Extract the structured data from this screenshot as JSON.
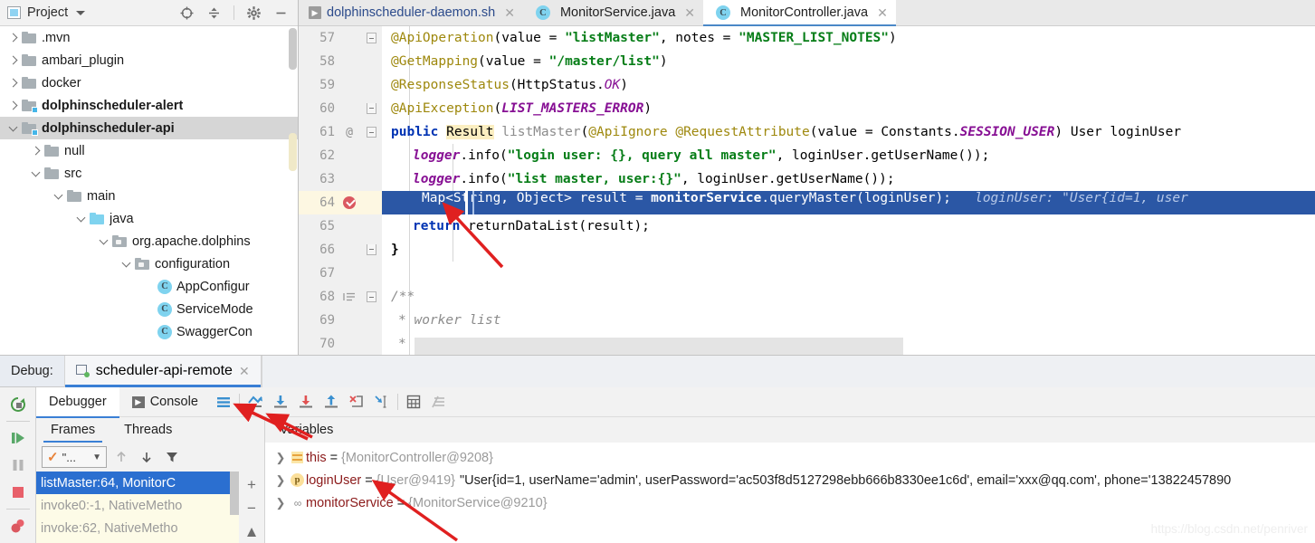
{
  "project_panel": {
    "title": "Project",
    "header_icons": [
      "locate-icon",
      "collapse-all-icon",
      "gear-icon",
      "minimize-icon"
    ],
    "tree": [
      {
        "label": ".mvn",
        "indent": 1,
        "arrow": "right",
        "icon": "folder",
        "bold": false
      },
      {
        "label": "ambari_plugin",
        "indent": 1,
        "arrow": "right",
        "icon": "folder",
        "bold": false
      },
      {
        "label": "docker",
        "indent": 1,
        "arrow": "right",
        "icon": "folder",
        "bold": false
      },
      {
        "label": "dolphinscheduler-alert",
        "indent": 1,
        "arrow": "right",
        "icon": "module",
        "bold": true
      },
      {
        "label": "dolphinscheduler-api",
        "indent": 1,
        "arrow": "down",
        "icon": "module",
        "bold": true,
        "selected": true
      },
      {
        "label": "null",
        "indent": 2,
        "arrow": "right",
        "icon": "folder",
        "bold": false
      },
      {
        "label": "src",
        "indent": 2,
        "arrow": "down",
        "icon": "folder",
        "bold": false
      },
      {
        "label": "main",
        "indent": 3,
        "arrow": "down",
        "icon": "folder",
        "bold": false
      },
      {
        "label": "java",
        "indent": 4,
        "arrow": "down",
        "icon": "folder-blue",
        "bold": false
      },
      {
        "label": "org.apache.dolphins",
        "indent": 5,
        "arrow": "down",
        "icon": "package",
        "bold": false
      },
      {
        "label": "configuration",
        "indent": 6,
        "arrow": "down",
        "icon": "package",
        "bold": false
      },
      {
        "label": "AppConfigur",
        "indent": 7,
        "arrow": "none",
        "icon": "class",
        "bold": false
      },
      {
        "label": "ServiceMode",
        "indent": 7,
        "arrow": "none",
        "icon": "class",
        "bold": false
      },
      {
        "label": "SwaggerCon",
        "indent": 7,
        "arrow": "none",
        "icon": "class",
        "bold": false
      }
    ]
  },
  "editor": {
    "tabs": [
      {
        "label": "dolphinscheduler-daemon.sh",
        "icon": "shell-script-icon",
        "active": false
      },
      {
        "label": "MonitorService.java",
        "icon": "class-icon",
        "active": false
      },
      {
        "label": "MonitorController.java",
        "icon": "class-icon",
        "active": true
      }
    ],
    "lines": [
      {
        "num": "57",
        "fold": "start",
        "marker": ""
      },
      {
        "num": "58",
        "fold": "",
        "marker": ""
      },
      {
        "num": "59",
        "fold": "",
        "marker": ""
      },
      {
        "num": "60",
        "fold": "end",
        "marker": ""
      },
      {
        "num": "61",
        "fold": "start",
        "marker": "@"
      },
      {
        "num": "62",
        "fold": "",
        "marker": ""
      },
      {
        "num": "63",
        "fold": "",
        "marker": ""
      },
      {
        "num": "64",
        "fold": "",
        "marker": "breakpoint"
      },
      {
        "num": "65",
        "fold": "",
        "marker": ""
      },
      {
        "num": "66",
        "fold": "end",
        "marker": ""
      },
      {
        "num": "67",
        "fold": "",
        "marker": ""
      },
      {
        "num": "68",
        "fold": "start",
        "marker": "javadoc"
      },
      {
        "num": "69",
        "fold": "",
        "marker": ""
      },
      {
        "num": "70",
        "fold": "",
        "marker": ""
      }
    ],
    "code": {
      "l57": "@ApiOperation(value = \"listMaster\", notes = \"MASTER_LIST_NOTES\")",
      "l58": "@GetMapping(value = \"/master/list\")",
      "l59": "@ResponseStatus(HttpStatus.OK)",
      "l60": "@ApiException(LIST_MASTERS_ERROR)",
      "l61": "public Result listMaster(@ApiIgnore @RequestAttribute(value = Constants.SESSION_USER) User loginUser",
      "l62": "logger.info(\"login user: {}, query all master\", loginUser.getUserName());",
      "l63": "logger.info(\"list master, user:{}\", loginUser.getUserName());",
      "l64": "Map<String, Object> result = monitorService.queryMaster(loginUser);",
      "l64_hint": "loginUser: \"User{id=1, user",
      "l65": "return returnDataList(result);",
      "l66": "}",
      "l68": "/**",
      "l69": " * worker list",
      "l70": " *"
    }
  },
  "debug": {
    "panel_label": "Debug:",
    "session_tab": "scheduler-api-remote",
    "sidebar_buttons": [
      "rerun-icon",
      "resume-program-icon",
      "pause-program-icon",
      "stop-icon",
      "view-breakpoints-icon"
    ],
    "tabs": [
      {
        "label": "Debugger",
        "active": true
      },
      {
        "label": "Console",
        "active": false
      }
    ],
    "toolbar_icons": [
      "layout-settings-icon",
      "show-execution-point-icon",
      "step-over-icon",
      "step-into-icon",
      "step-out-icon",
      "force-step-into-icon",
      "run-to-cursor-icon",
      "evaluate-expression-icon",
      "mute-breakpoints-icon"
    ],
    "frames_pane": {
      "tabs": [
        {
          "label": "Frames",
          "active": true
        },
        {
          "label": "Threads",
          "active": false
        }
      ],
      "thread_selector": "\"...",
      "tool_icons": [
        "up-arrow-icon",
        "down-arrow-icon",
        "filter-icon"
      ],
      "frames": [
        {
          "label": "listMaster:64, MonitorC",
          "selected": true
        },
        {
          "label": "invoke0:-1, NativeMetho",
          "selected": false
        },
        {
          "label": "invoke:62, NativeMetho",
          "selected": false
        }
      ],
      "side_buttons": [
        "add-icon",
        "remove-icon",
        "scroll-up-icon"
      ]
    },
    "variables_pane": {
      "tab_label": "Variables",
      "variables": [
        {
          "icon": "this-field-icon",
          "name": "this",
          "ref": "{MonitorController@9208}",
          "value": ""
        },
        {
          "icon": "parameter-icon",
          "name": "loginUser",
          "ref": "{User@9419}",
          "value": "\"User{id=1, userName='admin', userPassword='ac503f8d5127298ebb666b8330ee1c6d', email='xxx@qq.com', phone='13822457890"
        },
        {
          "icon": "field-link-icon",
          "name": "monitorService",
          "ref": "{MonitorService@9210}",
          "value": ""
        }
      ]
    }
  },
  "watermark": "https://blog.csdn.net/penriver",
  "colors": {
    "selection_blue": "#2b57a5",
    "frame_selected_blue": "#2b6fd0",
    "accent_blue": "#3a7fd5",
    "breakpoint_red": "#db5860",
    "annotation_arrow_red": "#e02020",
    "string_green": "#067d17",
    "keyword_blue": "#0033b3",
    "annotation_yellow": "#9e880d",
    "field_purple": "#871094"
  }
}
